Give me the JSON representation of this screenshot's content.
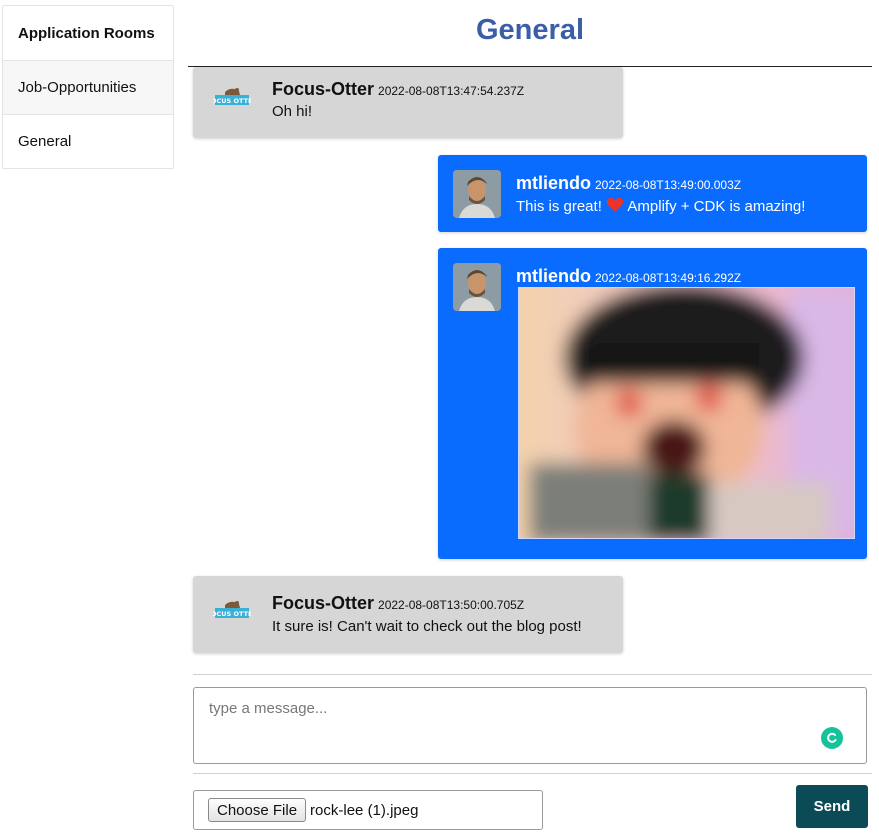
{
  "sidebar": {
    "heading": "Application Rooms",
    "items": [
      {
        "label": "Job-Opportunities"
      },
      {
        "label": "General"
      }
    ]
  },
  "room": {
    "title": "General"
  },
  "messages": [
    {
      "author": "Focus-Otter",
      "timestamp": "2022-08-08T13:47:54.237Z",
      "text": "Oh hi!",
      "avatar": "focus-otter-logo",
      "attached_logo_text": "FOCUS OTTER"
    },
    {
      "author": "mtliendo",
      "timestamp": "2022-08-08T13:49:00.003Z",
      "text_before_icon": "This is great!",
      "icon": "heart-icon",
      "text_after_icon": "Amplify + CDK is amazing!",
      "avatar": "person-photo"
    },
    {
      "author": "mtliendo",
      "timestamp": "2022-08-08T13:49:16.292Z",
      "attachment": "blurred-image",
      "avatar": "person-photo"
    },
    {
      "author": "Focus-Otter",
      "timestamp": "2022-08-08T13:50:00.705Z",
      "text": "It sure is! Can't wait to check out the blog post!",
      "avatar": "focus-otter-logo",
      "attached_logo_text": "FOCUS OTTER"
    }
  ],
  "composer": {
    "placeholder": "type a message...",
    "value": "",
    "choose_file_label": "Choose File",
    "file_name": "rock-lee (1).jpeg",
    "send_label": "Send"
  },
  "colors": {
    "title": "#3b5ea8",
    "my_message": "#0a6cff",
    "other_message": "#d6d6d6",
    "send_button": "#0b4a57",
    "grammar_badge": "#15c39a"
  }
}
